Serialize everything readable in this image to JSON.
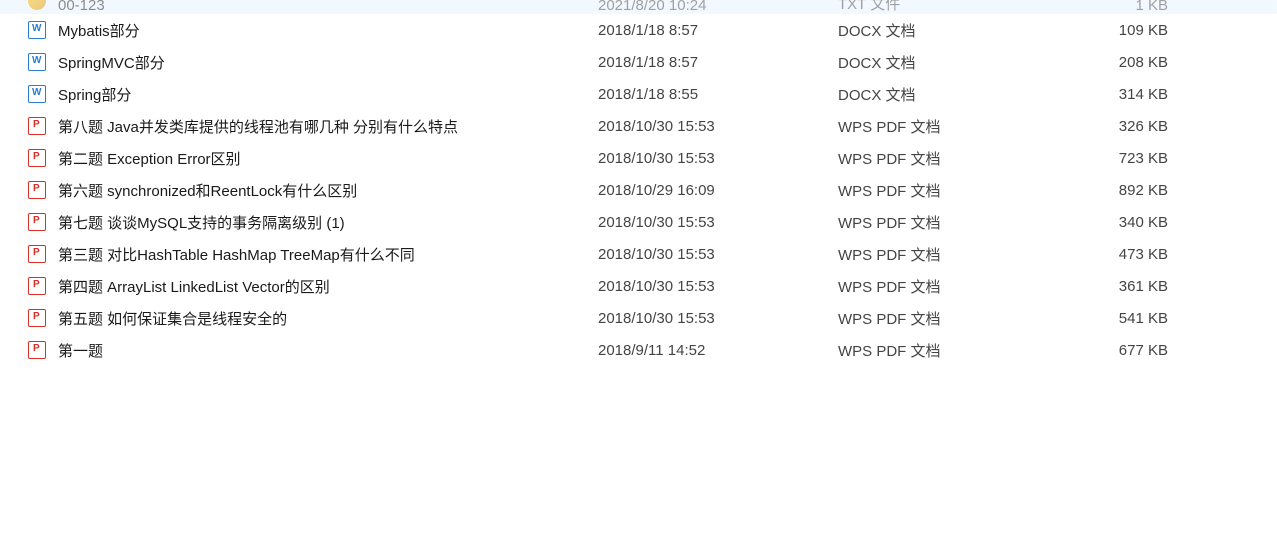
{
  "files": [
    {
      "name": "00-123",
      "date": "2021/8/20 10:24",
      "type": "TXT 文件",
      "size": "1 KB",
      "icon": "txt"
    },
    {
      "name": "Mybatis部分",
      "date": "2018/1/18 8:57",
      "type": "DOCX 文档",
      "size": "109 KB",
      "icon": "docx"
    },
    {
      "name": "SpringMVC部分",
      "date": "2018/1/18 8:57",
      "type": "DOCX 文档",
      "size": "208 KB",
      "icon": "docx"
    },
    {
      "name": "Spring部分",
      "date": "2018/1/18 8:55",
      "type": "DOCX 文档",
      "size": "314 KB",
      "icon": "docx"
    },
    {
      "name": "第八题 Java并发类库提供的线程池有哪几种 分别有什么特点",
      "date": "2018/10/30 15:53",
      "type": "WPS PDF 文档",
      "size": "326 KB",
      "icon": "pdf"
    },
    {
      "name": "第二题 Exception Error区别",
      "date": "2018/10/30 15:53",
      "type": "WPS PDF 文档",
      "size": "723 KB",
      "icon": "pdf"
    },
    {
      "name": "第六题 synchronized和ReentLock有什么区别",
      "date": "2018/10/29 16:09",
      "type": "WPS PDF 文档",
      "size": "892 KB",
      "icon": "pdf"
    },
    {
      "name": "第七题 谈谈MySQL支持的事务隔离级别 (1)",
      "date": "2018/10/30 15:53",
      "type": "WPS PDF 文档",
      "size": "340 KB",
      "icon": "pdf"
    },
    {
      "name": "第三题 对比HashTable HashMap TreeMap有什么不同",
      "date": "2018/10/30 15:53",
      "type": "WPS PDF 文档",
      "size": "473 KB",
      "icon": "pdf"
    },
    {
      "name": "第四题 ArrayList LinkedList Vector的区别",
      "date": "2018/10/30 15:53",
      "type": "WPS PDF 文档",
      "size": "361 KB",
      "icon": "pdf"
    },
    {
      "name": "第五题 如何保证集合是线程安全的",
      "date": "2018/10/30 15:53",
      "type": "WPS PDF 文档",
      "size": "541 KB",
      "icon": "pdf"
    },
    {
      "name": "第一题",
      "date": "2018/9/11 14:52",
      "type": "WPS PDF 文档",
      "size": "677 KB",
      "icon": "pdf"
    }
  ]
}
